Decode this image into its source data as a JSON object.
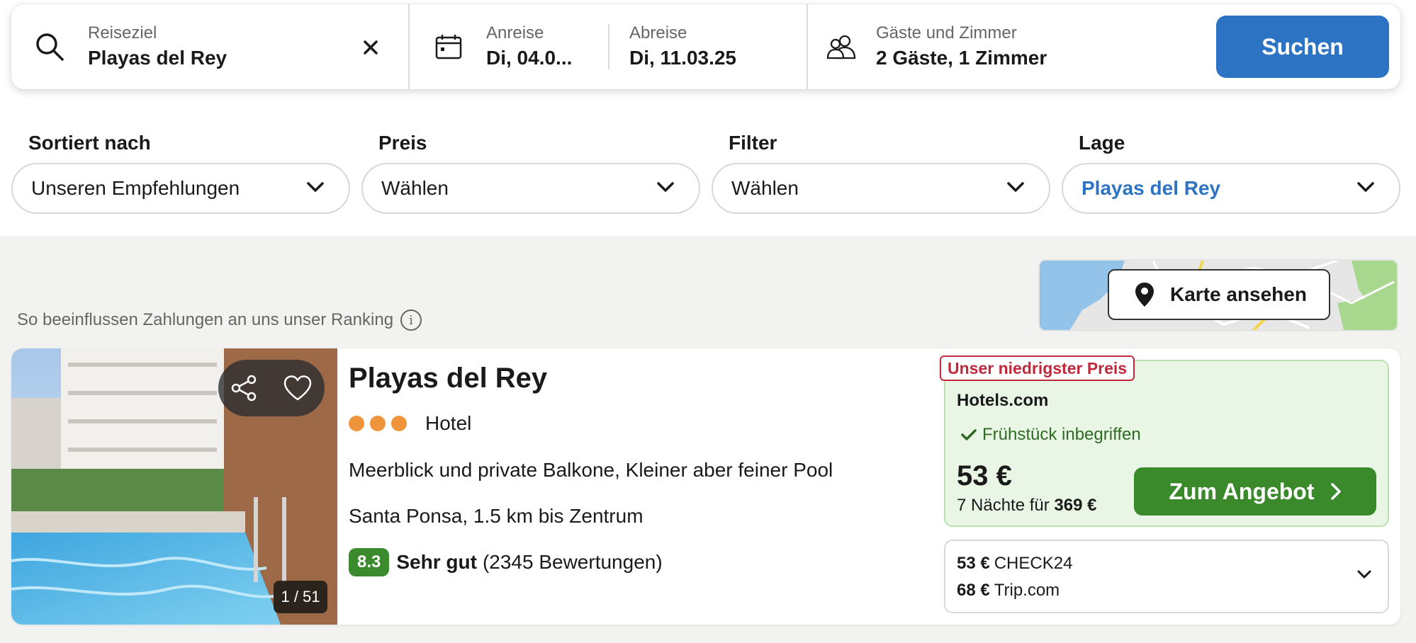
{
  "search": {
    "destination_label": "Reiseziel",
    "destination_value": "Playas del Rey",
    "checkin_label": "Anreise",
    "checkin_value": "Di, 04.0...",
    "checkout_label": "Abreise",
    "checkout_value": "Di, 11.03.25",
    "guests_label": "Gäste und Zimmer",
    "guests_value": "2 Gäste, 1 Zimmer",
    "search_button": "Suchen"
  },
  "filters": [
    {
      "label": "Sortiert nach",
      "value": "Unseren Empfehlungen"
    },
    {
      "label": "Preis",
      "value": "Wählen"
    },
    {
      "label": "Filter",
      "value": "Wählen"
    },
    {
      "label": "Lage",
      "value": "Playas del Rey"
    }
  ],
  "ranking_note": "So beeinflussen Zahlungen an uns unser Ranking",
  "map_button": "Karte ansehen",
  "hotel": {
    "name": "Playas del Rey",
    "stars": 3,
    "type": "Hotel",
    "description": "Meerblick und private Balkone, Kleiner aber feiner Pool",
    "location": "Santa Ponsa, 1.5 km bis Zentrum",
    "rating_score": "8.3",
    "rating_word": "Sehr gut",
    "rating_count": "(2345 Bewertungen)",
    "photo_counter": "1 / 51"
  },
  "offer": {
    "badge": "Unser niedrigster Preis",
    "provider": "Hotels.com",
    "feature": "Frühstück inbegriffen",
    "price": "53 €",
    "nights_text": "7 Nächte für",
    "total": "369 €",
    "cta": "Zum Angebot"
  },
  "other_offers": [
    {
      "price": "53 €",
      "provider": "CHECK24"
    },
    {
      "price": "68 €",
      "provider": "Trip.com"
    }
  ],
  "colors": {
    "accent_blue": "#2c74c3",
    "cta_green": "#3a8a2c",
    "badge_red": "#c0293c",
    "star_orange": "#f0943b"
  }
}
